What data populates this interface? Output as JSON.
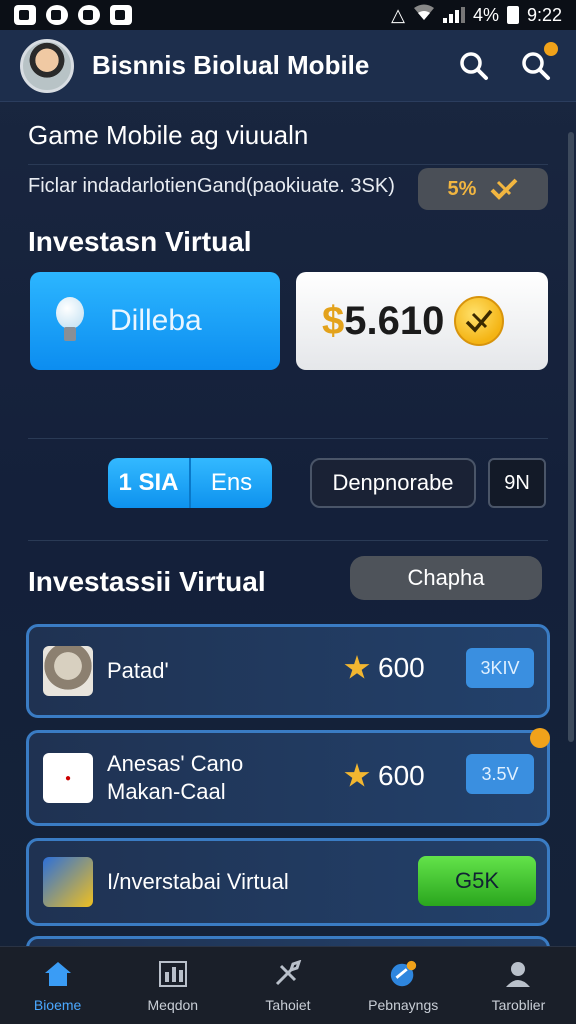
{
  "status_bar": {
    "battery_percent": "4%",
    "time": "9:22"
  },
  "app_bar": {
    "title": "Bisnnis Biolual Mobile"
  },
  "page": {
    "subtitle": "Game Mobile ag viuualn",
    "info_text": "Ficlar indadarlotienGand(paokiuate. 3SK)",
    "percent_pill": {
      "value": "5%"
    }
  },
  "section1": {
    "title": "Investasn Virtual",
    "blue_button_label": "Dilleba",
    "balance": "5.610",
    "balance_symbol": "$"
  },
  "controls": {
    "seg_left": "1 SIA",
    "seg_right": "Ens",
    "outline_button": "Denpnorabe",
    "small_button": "9N"
  },
  "section2": {
    "title": "Investassii Virtual",
    "pill_label": "Chapha"
  },
  "list": [
    {
      "label_line1": "Patad'",
      "label_line2": "",
      "amount": "600",
      "tag": "3KIV"
    },
    {
      "label_line1": "Anesas' Cano",
      "label_line2": "Makan-Caal",
      "amount": "600",
      "tag": "3.5V"
    },
    {
      "label_line1": "I/nverstabai Virtual",
      "label_line2": "",
      "button": "G5K"
    }
  ],
  "bottom_nav": [
    {
      "label": "Bioeme",
      "icon": "home-icon"
    },
    {
      "label": "Meqdon",
      "icon": "chart-icon"
    },
    {
      "label": "Tahoiet",
      "icon": "tools-icon"
    },
    {
      "label": "Pebnayngs",
      "icon": "paint-icon"
    },
    {
      "label": "Taroblier",
      "icon": "profile-icon"
    }
  ],
  "colors": {
    "accent_blue": "#0e92ee",
    "gold": "#f2b630",
    "green": "#2aa61e",
    "background": "#14203a"
  }
}
